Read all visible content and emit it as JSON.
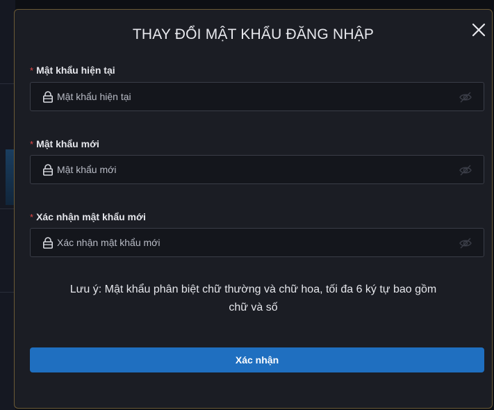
{
  "dialog": {
    "title": "THAY ĐỔI MẬT KHẨU ĐĂNG NHẬP",
    "close_icon": "close-icon"
  },
  "fields": [
    {
      "required_mark": "*",
      "label": "Mật khẩu hiện tại",
      "placeholder": "Mật khẩu hiện tại",
      "value": "",
      "leading_icon": "lock-icon",
      "trailing_icon": "eye-off-icon"
    },
    {
      "required_mark": "*",
      "label": "Mật khẩu mới",
      "placeholder": "Mật khẩu mới",
      "value": "",
      "leading_icon": "lock-icon",
      "trailing_icon": "eye-off-icon"
    },
    {
      "required_mark": "*",
      "label": "Xác nhận mật khẩu mới",
      "placeholder": "Xác nhận mật khẩu mới",
      "value": "",
      "leading_icon": "lock-icon",
      "trailing_icon": "eye-off-icon"
    }
  ],
  "note": {
    "line1": "Lưu ý: Mật khẩu phân biệt chữ thường và chữ hoa, tối đa 6 ký tự bao gồm",
    "line2": "chữ và số"
  },
  "submit": {
    "label": "Xác nhận"
  },
  "colors": {
    "accent": "#1f6fc0",
    "dialog_bg": "#1b1d24",
    "dialog_border": "#6b5a36",
    "required": "#e04848"
  }
}
